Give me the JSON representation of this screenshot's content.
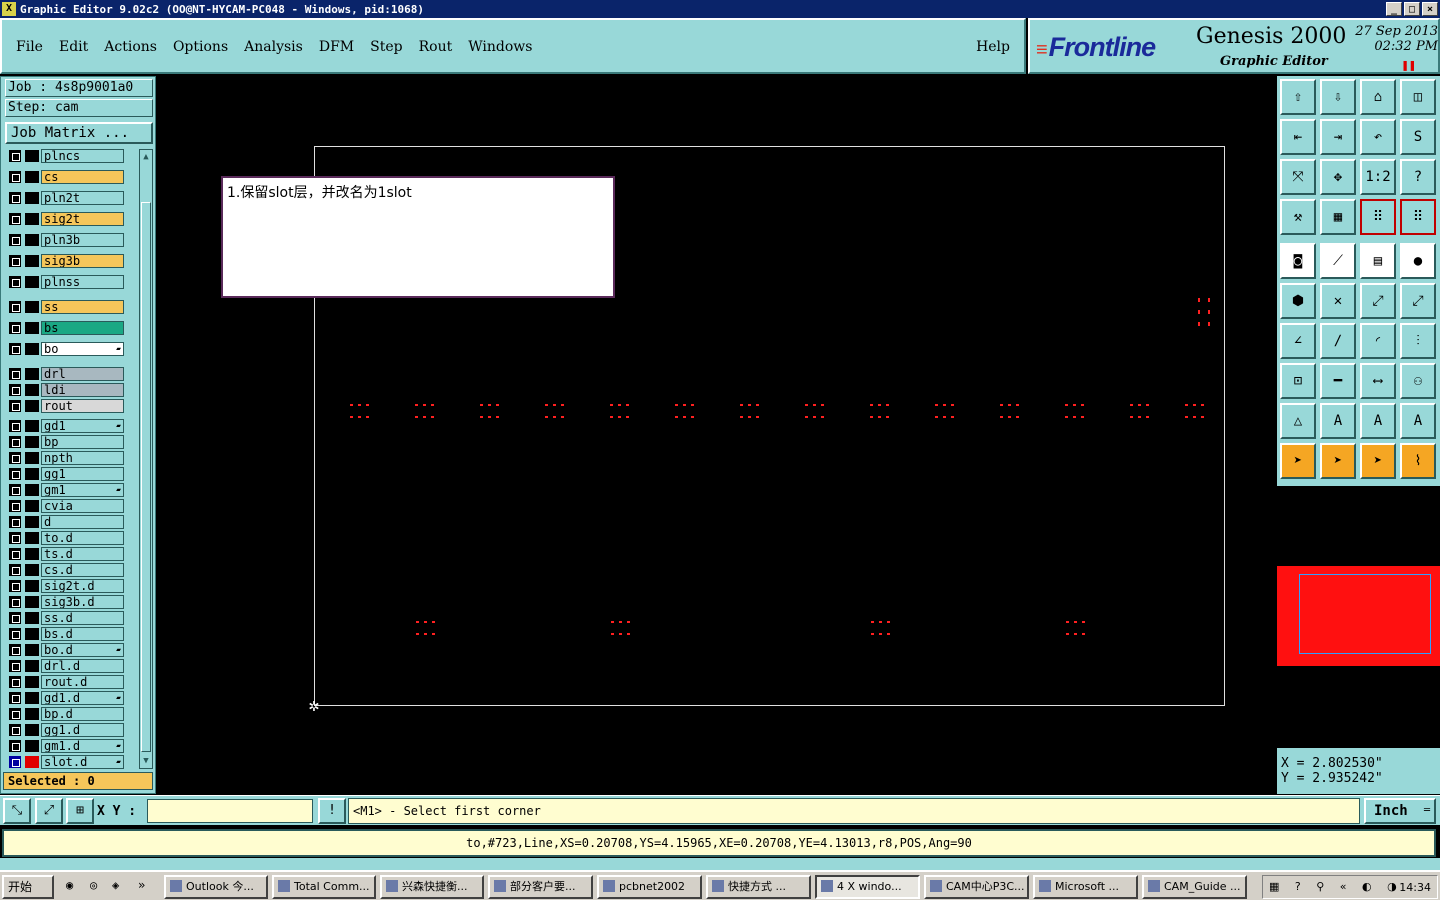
{
  "window": {
    "title": "Graphic Editor 9.02c2 (OO@NT-HYCAM-PC048 - Windows, pid:1068)",
    "buttons": [
      "_",
      "□",
      "×"
    ]
  },
  "menu": {
    "items": [
      "File",
      "Edit",
      "Actions",
      "Options",
      "Analysis",
      "DFM",
      "Step",
      "Rout",
      "Windows"
    ],
    "help": "Help"
  },
  "brand": {
    "logo": "Frontline",
    "product": "Genesis 2000",
    "subtitle": "Graphic Editor",
    "date": "27 Sep 2013",
    "time": "02:32 PM"
  },
  "job": {
    "job_line": "Job : 4s8p9001a0",
    "step_line": "Step: cam",
    "matrix_button": "Job Matrix ..."
  },
  "layers": [
    {
      "name": "plncs",
      "color": "#98d8d8"
    },
    {
      "name": "cs",
      "color": "#f5c65a"
    },
    {
      "name": "pln2t",
      "color": "#98d8d8"
    },
    {
      "name": "sig2t",
      "color": "#f5c65a"
    },
    {
      "name": "pln3b",
      "color": "#98d8d8"
    },
    {
      "name": "sig3b",
      "color": "#f5c65a"
    },
    {
      "name": "plnss",
      "color": "#98d8d8"
    },
    {
      "name": "ss",
      "color": "#f5c65a"
    },
    {
      "name": "bs",
      "color": "#1aa884"
    },
    {
      "name": "bo",
      "color": "#ffffff",
      "mark": true
    },
    {
      "name": "drl",
      "color": "#a8b8c0"
    },
    {
      "name": "ldi",
      "color": "#a8b8c0"
    },
    {
      "name": "rout",
      "color": "#d8d8d8"
    },
    {
      "name": "gd1",
      "color": "#98d8d8",
      "mark": true
    },
    {
      "name": "bp",
      "color": "#98d8d8"
    },
    {
      "name": "npth",
      "color": "#98d8d8"
    },
    {
      "name": "gg1",
      "color": "#98d8d8"
    },
    {
      "name": "gm1",
      "color": "#98d8d8",
      "mark": true
    },
    {
      "name": "cvia",
      "color": "#98d8d8"
    },
    {
      "name": "d",
      "color": "#98d8d8"
    },
    {
      "name": "to.d",
      "color": "#98d8d8"
    },
    {
      "name": "ts.d",
      "color": "#98d8d8"
    },
    {
      "name": "cs.d",
      "color": "#98d8d8"
    },
    {
      "name": "sig2t.d",
      "color": "#98d8d8"
    },
    {
      "name": "sig3b.d",
      "color": "#98d8d8"
    },
    {
      "name": "ss.d",
      "color": "#98d8d8"
    },
    {
      "name": "bs.d",
      "color": "#98d8d8"
    },
    {
      "name": "bo.d",
      "color": "#98d8d8",
      "mark": true
    },
    {
      "name": "drl.d",
      "color": "#98d8d8"
    },
    {
      "name": "rout.d",
      "color": "#98d8d8"
    },
    {
      "name": "gd1.d",
      "color": "#98d8d8",
      "mark": true
    },
    {
      "name": "bp.d",
      "color": "#98d8d8"
    },
    {
      "name": "gg1.d",
      "color": "#98d8d8"
    },
    {
      "name": "gm1.d",
      "color": "#98d8d8",
      "mark": true
    },
    {
      "name": "slot.d",
      "color": "#98d8d8",
      "active": true,
      "mark": true
    }
  ],
  "selected": "Selected : 0",
  "note": "1.保留slot层，并改名为1slot",
  "coords": {
    "x": "X = 2.802530\"",
    "y": "Y = 2.935242\""
  },
  "prompt": {
    "xy_label": "X Y :",
    "xy_value": "",
    "info_button": "!",
    "message": "<M1> - Select first corner",
    "units": "Inch"
  },
  "status": "to,#723,Line,XS=0.20708,YS=4.15965,XE=0.20708,YE=4.13013,r8,POS,Ang=90",
  "taskbar": {
    "start": "开始",
    "tasks": [
      {
        "label": "Outlook 今..."
      },
      {
        "label": "Total Comm..."
      },
      {
        "label": "兴森快捷衡..."
      },
      {
        "label": "部分客户要..."
      },
      {
        "label": "pcbnet2002"
      },
      {
        "label": "快捷方式 ..."
      },
      {
        "label": "4 X windo...",
        "active": true
      },
      {
        "label": "CAM中心P3C..."
      },
      {
        "label": "Microsoft ..."
      },
      {
        "label": "CAM_Guide ..."
      }
    ],
    "clock": "14:34"
  }
}
